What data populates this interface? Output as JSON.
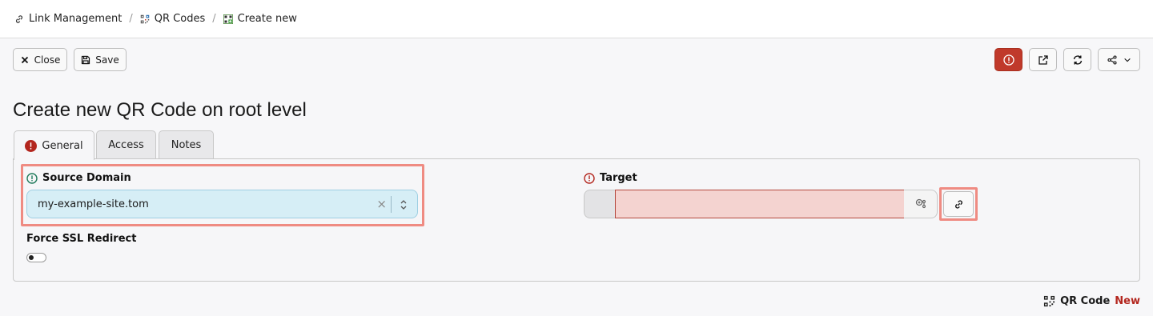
{
  "breadcrumb": {
    "items": [
      {
        "label": "Link Management",
        "icon": "link-icon"
      },
      {
        "label": "QR Codes",
        "icon": "qr-code-icon"
      },
      {
        "label": "Create new",
        "icon": "qr-code-new-icon"
      }
    ],
    "separator": "/"
  },
  "toolbar": {
    "close_label": "Close",
    "save_label": "Save",
    "alert_icon": "exclamation-circle-icon",
    "external_icon": "external-link-icon",
    "reload_icon": "reload-icon",
    "share_icon": "share-icon"
  },
  "page": {
    "title": "Create new QR Code on root level"
  },
  "tabs": [
    {
      "label": "General",
      "active": true,
      "has_error": true
    },
    {
      "label": "Access",
      "active": false
    },
    {
      "label": "Notes",
      "active": false
    }
  ],
  "form": {
    "source_domain": {
      "label": "Source Domain",
      "value": "my-example-site.tom",
      "clear_glyph": "×"
    },
    "target": {
      "label": "Target",
      "value": ""
    },
    "force_ssl": {
      "label": "Force SSL Redirect",
      "enabled": false
    }
  },
  "footer": {
    "record_type": "QR Code",
    "state": "New"
  },
  "colors": {
    "accent_danger": "#c0392b",
    "highlight": "#ef8b82",
    "select_bg": "#d6eef6",
    "error_input_bg": "#f4d3d0",
    "info": "#1f7a5a"
  }
}
